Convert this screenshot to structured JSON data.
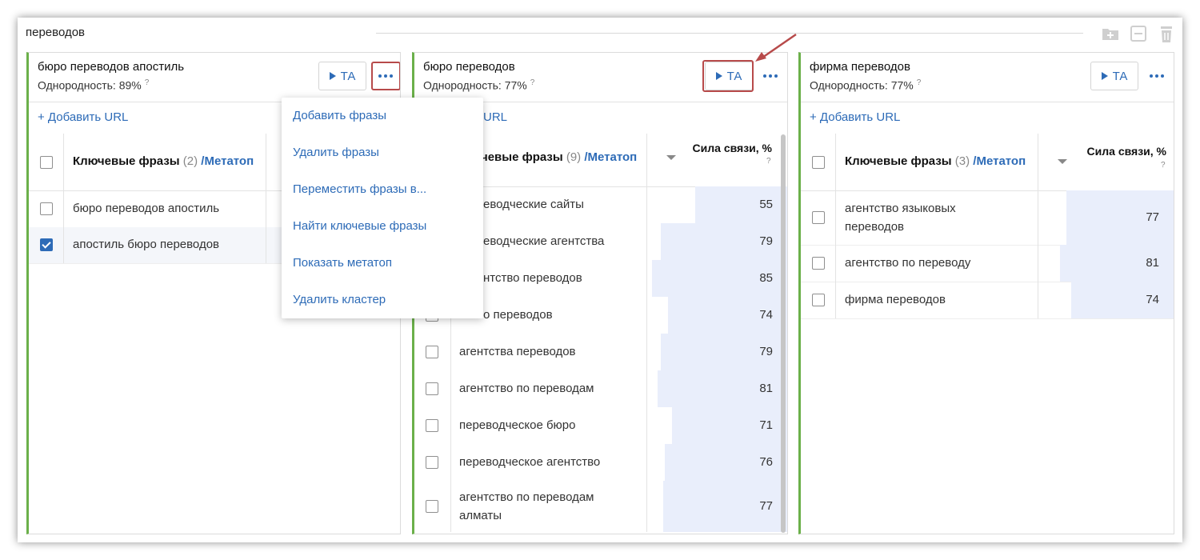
{
  "group": {
    "title": "переводов",
    "tools": [
      "add-folder-icon",
      "collapse-icon",
      "trash-icon"
    ]
  },
  "clusters": [
    {
      "name": "бюро переводов апостиль",
      "homogeneity": "Однородность: 89%",
      "hint": "?",
      "ta_label": "ТА",
      "add_url": "+ Добавить URL",
      "header": {
        "keyphrases": "Ключевые фразы",
        "count": "(2)",
        "sep": "/",
        "metatop": "Метатоп"
      },
      "rows": [
        {
          "phrase": "бюро переводов апостиль",
          "checked": false
        },
        {
          "phrase": "апостиль бюро переводов",
          "checked": true
        }
      ]
    },
    {
      "name": "бюро переводов",
      "homogeneity": "Однородность: 77%",
      "hint": "?",
      "ta_label": "ТА",
      "add_url": "URL",
      "header": {
        "keyphrases": "чевые фразы",
        "count": "(9)",
        "sep": "/",
        "metatop": "Метатоп",
        "strength": "Сила связи, %",
        "strength_hint": "?"
      },
      "rows": [
        {
          "phrase": "еводческие сайты",
          "value": "55"
        },
        {
          "phrase": "еводческие агентства",
          "value": "79"
        },
        {
          "phrase": "нтство переводов",
          "value": "85"
        },
        {
          "phrase": "о переводов",
          "value": "74"
        },
        {
          "phrase": "агентства переводов",
          "value": "79"
        },
        {
          "phrase": "агентство по переводам",
          "value": "81"
        },
        {
          "phrase": "переводческое бюро",
          "value": "71"
        },
        {
          "phrase": "переводческое агентство",
          "value": "76"
        },
        {
          "phrase_line1": "агентство по переводам",
          "phrase_line2": "алматы",
          "value": "77"
        }
      ]
    },
    {
      "name": "фирма переводов",
      "homogeneity": "Однородность: 77%",
      "hint": "?",
      "ta_label": "ТА",
      "add_url": "+ Добавить URL",
      "header": {
        "keyphrases": "Ключевые фразы",
        "count": "(3)",
        "sep": "/",
        "metatop": "Метатоп",
        "strength": "Сила связи, %",
        "strength_hint": "?"
      },
      "rows": [
        {
          "phrase_line1": "агентство языковых",
          "phrase_line2": "переводов",
          "value": "77"
        },
        {
          "phrase": "агентство по переводу",
          "value": "81"
        },
        {
          "phrase": "фирма переводов",
          "value": "74"
        }
      ]
    }
  ],
  "menu": {
    "items": [
      "Добавить фразы",
      "Удалить фразы",
      "Переместить фразы в...",
      "Найти ключевые фразы",
      "Показать метатоп",
      "Удалить кластер"
    ]
  },
  "colors": {
    "accent": "#2d6bb7",
    "cluster_border": "#6bb04a",
    "highlight": "#b74a4a",
    "bar": "#e9eefb"
  }
}
